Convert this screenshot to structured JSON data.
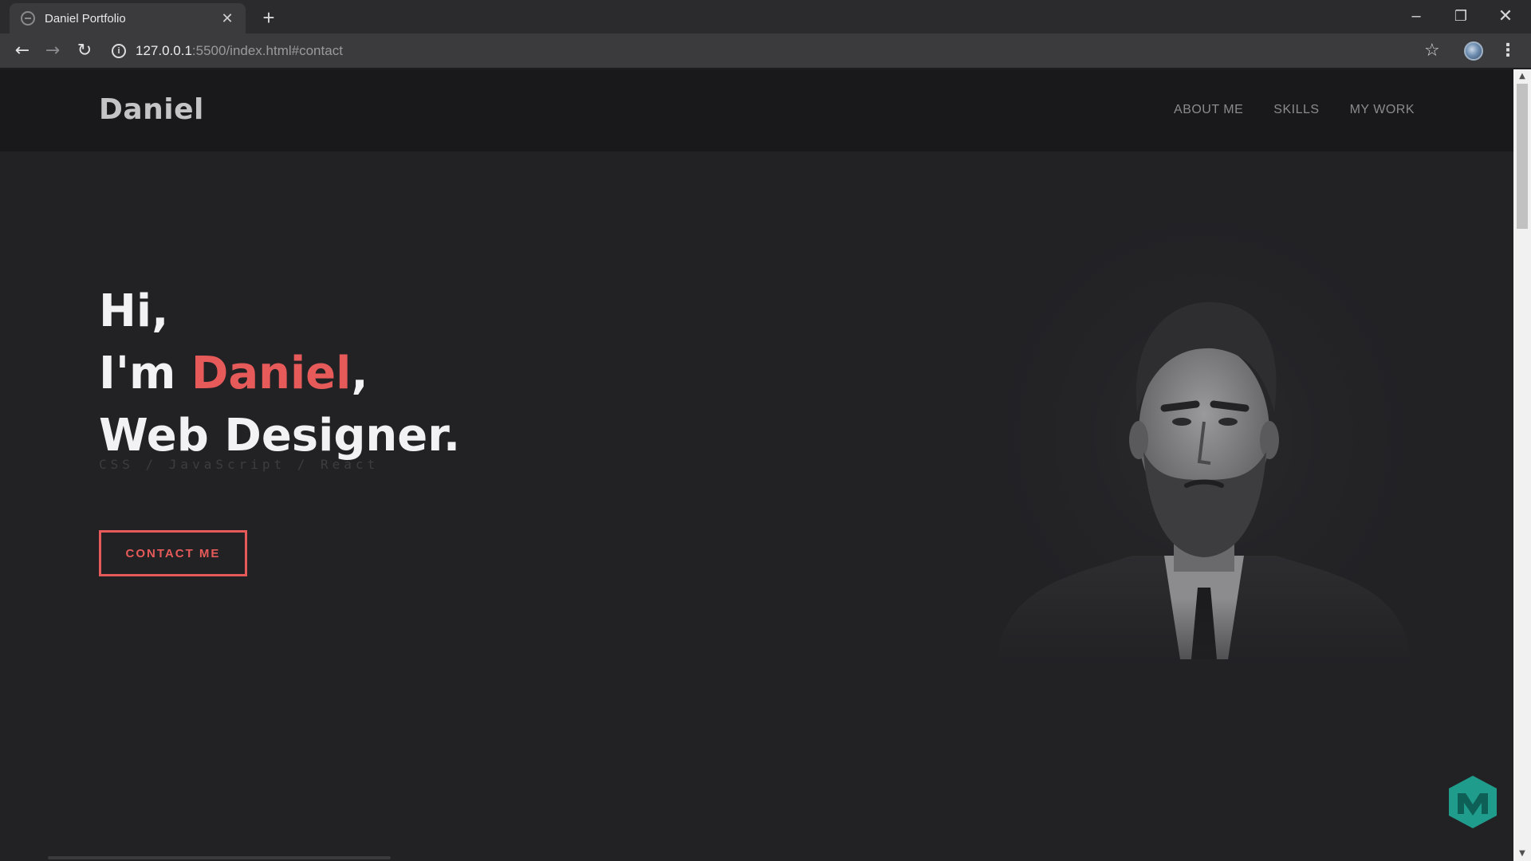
{
  "browser": {
    "tab_title": "Daniel Portfolio",
    "tab_close": "✕",
    "new_tab": "+",
    "url_host": "127.0.0.1",
    "url_rest": ":5500/index.html#contact",
    "window_controls": {
      "minimize": "–",
      "maximize": "❐",
      "close": "✕"
    },
    "icons": [
      "back-arrow-icon",
      "forward-arrow-icon",
      "reload-icon",
      "info-icon",
      "star-icon",
      "profile-icon",
      "kebab-menu-icon"
    ]
  },
  "site": {
    "logo": "Daniel",
    "nav": [
      {
        "label": "ABOUT ME"
      },
      {
        "label": "SKILLS"
      },
      {
        "label": "MY WORK"
      }
    ],
    "hero": {
      "line1": "Hi,",
      "line2_prefix": "I'm ",
      "line2_name": "Daniel",
      "line2_suffix": ",",
      "line3": "Web Designer.",
      "skills": "CSS  /  JavaScript  /  React",
      "cta": "CONTACT ME"
    }
  },
  "colors": {
    "accent": "#e65a5a",
    "page_bg": "#222225",
    "nav_bg": "#19191b",
    "heading": "#f2f2f4"
  }
}
